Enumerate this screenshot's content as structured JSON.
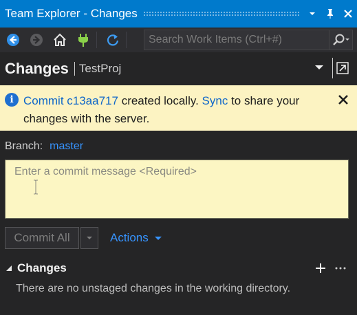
{
  "window": {
    "title": "Team Explorer - Changes",
    "dropdown_icon": "chevron-down-icon",
    "pin_icon": "pin-icon",
    "close_icon": "close-icon"
  },
  "toolbar": {
    "back_icon": "back-arrow-icon",
    "forward_icon": "forward-arrow-icon",
    "home_icon": "home-icon",
    "connect_icon": "plug-icon",
    "refresh_icon": "refresh-icon",
    "search_placeholder": "Search Work Items (Ctrl+#)",
    "search_icon": "search-icon"
  },
  "header": {
    "title": "Changes",
    "project": "TestProj"
  },
  "notification": {
    "prefix_link": "Commit c13aa717",
    "middle": " created locally. ",
    "sync_link": "Sync",
    "suffix": " to share your changes with the server."
  },
  "branch": {
    "label": "Branch:",
    "value": "master"
  },
  "commit": {
    "placeholder": "Enter a commit message <Required>",
    "button_label": "Commit All",
    "actions_label": "Actions"
  },
  "changes_section": {
    "title": "Changes",
    "empty_message": "There are no unstaged changes in the working directory."
  },
  "colors": {
    "accent": "#007acc",
    "link": "#3794ff",
    "info_background": "#fcf3c2",
    "panel_background": "#252526"
  }
}
